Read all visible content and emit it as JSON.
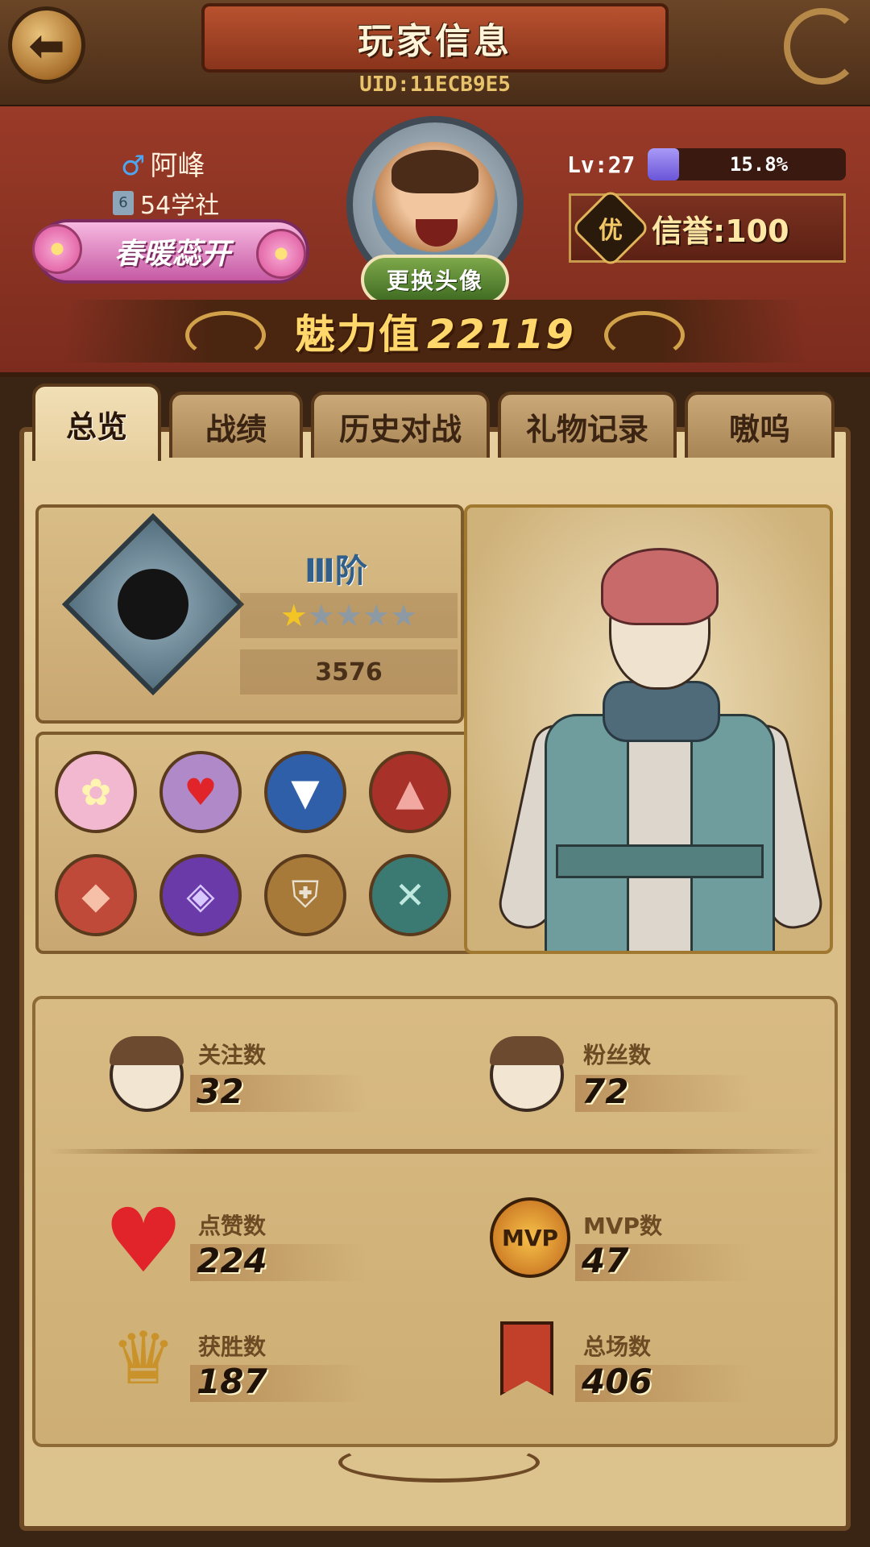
{
  "header": {
    "title": "玩家信息",
    "uid": "UID:11ECB9E5"
  },
  "profile": {
    "gender_symbol": "♂",
    "name": "阿峰",
    "school_level": "6",
    "school": "54学社",
    "title_badge": "春暖蕊开",
    "change_avatar_label": "更换头像",
    "level": "Lv:27",
    "level_progress_percent": 15.8,
    "level_progress_text": "15.8%",
    "credit_icon_text": "优",
    "credit": "信誉:100",
    "charm_label": "魅力值",
    "charm_value": "22119"
  },
  "tabs": [
    {
      "label": "总览",
      "active": true
    },
    {
      "label": "战绩",
      "active": false
    },
    {
      "label": "历史对战",
      "active": false
    },
    {
      "label": "礼物记录",
      "active": false
    },
    {
      "label": "嗷呜",
      "active": false
    }
  ],
  "rank": {
    "tier": "Ⅲ阶",
    "stars_filled": 1,
    "stars_total": 5,
    "points": "3576"
  },
  "achievements": [
    {
      "icon": "flower-badge-icon",
      "color": "#f2b8d0"
    },
    {
      "icon": "heart-badge-icon",
      "color": "#b08ac8"
    },
    {
      "icon": "white-wolf-badge-icon",
      "color": "#2e5fa8"
    },
    {
      "icon": "red-wolf-badge-icon",
      "color": "#a8312a"
    },
    {
      "icon": "werewolf-badge-icon",
      "color": "#c04a3a"
    },
    {
      "icon": "purple-mask-badge-icon",
      "color": "#6a3aa8"
    },
    {
      "icon": "shield-sword-badge-icon",
      "color": "#a87a3a"
    },
    {
      "icon": "crossbow-badge-icon",
      "color": "#3a7a72"
    }
  ],
  "stats": {
    "following": {
      "label": "关注数",
      "value": "32"
    },
    "followers": {
      "label": "粉丝数",
      "value": "72"
    },
    "likes": {
      "label": "点赞数",
      "value": "224"
    },
    "mvp": {
      "label": "MVP数",
      "value": "47",
      "icon_text": "MVP"
    },
    "wins": {
      "label": "获胜数",
      "value": "187"
    },
    "total": {
      "label": "总场数",
      "value": "406"
    }
  },
  "colors": {
    "accent_gold": "#ffd76a",
    "level_bar": "#7a66e0",
    "profile_red": "#8a3424",
    "parchment": "#e7cf9e"
  }
}
